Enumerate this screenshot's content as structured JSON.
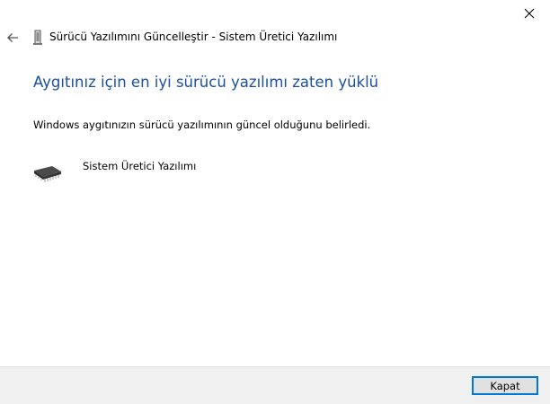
{
  "window": {
    "title": "Sürücü Yazılımını Güncelleştir - Sistem Üretici Yazılımı",
    "close_icon": "close-icon",
    "back_icon": "back-arrow-icon",
    "title_icon": "device-icon"
  },
  "main": {
    "heading": "Aygıtınız için en iyi sürücü yazılımı zaten yüklü",
    "status_text": "Windows aygıtınızın sürücü yazılımının güncel olduğunu belirledi.",
    "driver": {
      "icon": "chip-icon",
      "name": "Sistem Üretici Yazılımı"
    }
  },
  "footer": {
    "close_label": "Kapat"
  },
  "colors": {
    "heading": "#1c4fa0",
    "footer_bg": "#f0f0f0",
    "button_border": "#0078d7"
  }
}
